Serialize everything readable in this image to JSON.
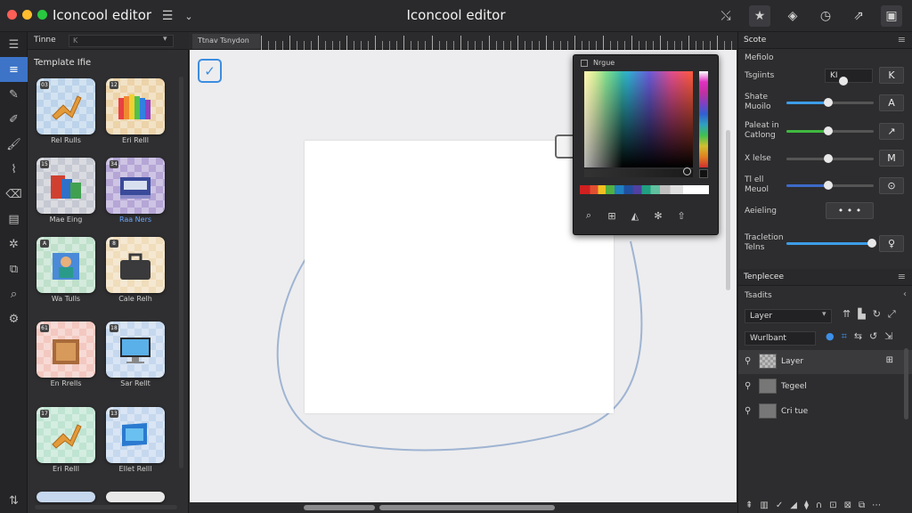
{
  "window": {
    "app_name": "Iconcool editor",
    "title": "Iconcool editor"
  },
  "traffic_lights": [
    "#fe5f57",
    "#febc2e",
    "#28c840"
  ],
  "title_icons": [
    "layers-icon",
    "chevron-down-icon",
    "nodes-icon",
    "star-icon",
    "share-icon",
    "help-icon",
    "export-icon",
    "panel-icon"
  ],
  "tools": [
    "pen-icon",
    "pencil-icon",
    "brush-icon",
    "paint-icon",
    "eraser-icon",
    "text-icon",
    "stamp-icon",
    "crop-icon",
    "zoom-icon",
    "settings-icon"
  ],
  "library": {
    "header_label": "Tinne",
    "header_select": "K",
    "subtitle": "Template Ifie",
    "tiles": [
      {
        "label": "Rel Rulls",
        "bg": "#bcd3ea",
        "badge": "03",
        "art": "figure",
        "highlight": false
      },
      {
        "label": "Eri Relll",
        "bg": "#ecd3a9",
        "badge": "12",
        "art": "rainbow",
        "highlight": false
      },
      {
        "label": "Mae Eing",
        "bg": "#c6c9d2",
        "badge": "15",
        "art": "books",
        "highlight": false
      },
      {
        "label": "Raa Ners",
        "bg": "#b5a6d6",
        "badge": "34",
        "art": "box",
        "highlight": true
      },
      {
        "label": "Wa Tulls",
        "bg": "#bfe0cb",
        "badge": "A",
        "art": "person",
        "highlight": false
      },
      {
        "label": "Cale Relh",
        "bg": "#f0ddbb",
        "badge": "8",
        "art": "bag",
        "highlight": false
      },
      {
        "label": "En Rrells",
        "bg": "#f3c8c0",
        "badge": "61",
        "art": "cabinet",
        "highlight": false
      },
      {
        "label": "Sar Rellt",
        "bg": "#c6d8ee",
        "badge": "18",
        "art": "monitor",
        "highlight": false
      },
      {
        "label": "Eri Relll",
        "bg": "#bfe4d2",
        "badge": "17",
        "art": "figure",
        "highlight": false
      },
      {
        "label": "Ellet Relll",
        "bg": "#c6d8ee",
        "badge": "13",
        "art": "screen",
        "highlight": false
      }
    ]
  },
  "canvas": {
    "tab_name": "Ttnav Tsnydon",
    "artboard_color": "#ffffff",
    "background_color": "#ededef"
  },
  "color_picker": {
    "header": "Nrgue"
  },
  "properties": {
    "section_title": "Scote",
    "subsection": "Mefiolo",
    "rows": [
      {
        "label": "Tsgiints",
        "field": "KI",
        "button": "K"
      },
      {
        "label": "Shate\nMuoilo",
        "value": 0.48,
        "color": "#3d9de8",
        "button": "A"
      },
      {
        "label": "Paleat in\nCatlong",
        "value": 0.48,
        "color": "#3fb840",
        "button": "↗"
      },
      {
        "label": "X lelse",
        "value": 0.48,
        "color": "#555",
        "button": "M"
      },
      {
        "label": "Tl ell\nMeuol",
        "value": 0.48,
        "color": "#3d6ac8",
        "button": "⊙"
      },
      {
        "label": "Aeieling",
        "value": 0,
        "color": "#555",
        "button": "• • •"
      },
      {
        "label": "Tracletion\nTelns",
        "value": 0.98,
        "color": "#3d9de8",
        "button": "♀"
      }
    ]
  },
  "layers": {
    "section_title": "Tenplecee",
    "subsection": "Tsadits",
    "select_value": "Layer",
    "field_value": "Wurlbant",
    "items": [
      {
        "name": "Layer",
        "selected": true,
        "checker": true
      },
      {
        "name": "Tegeel",
        "selected": false,
        "checker": false
      },
      {
        "name": "Cri tue",
        "selected": false,
        "checker": false
      }
    ]
  }
}
